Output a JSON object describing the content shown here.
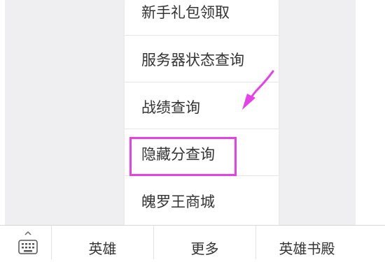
{
  "popup_menu": {
    "items": [
      {
        "label": "新手礼包领取"
      },
      {
        "label": "服务器状态查询"
      },
      {
        "label": "战绩查询"
      },
      {
        "label": "隐藏分查询"
      },
      {
        "label": "魄罗王商城"
      }
    ],
    "highlighted_item": "隐藏分查询",
    "annotation_color": "#e640e8"
  },
  "tabbar": {
    "keyboard_icon": "keyboard-icon",
    "tabs": [
      {
        "label": "英雄"
      },
      {
        "label": "更多"
      },
      {
        "label": "英雄书殿"
      }
    ]
  }
}
